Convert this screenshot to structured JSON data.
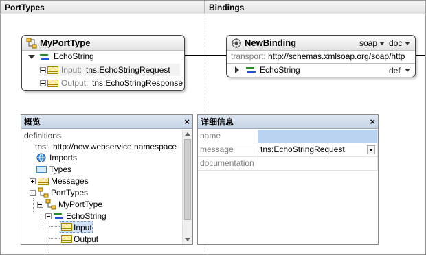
{
  "columns": {
    "port_types": "PortTypes",
    "bindings": "Bindings"
  },
  "port_type_box": {
    "title": "MyPortType",
    "operation": "EchoString",
    "input_label": "Input:",
    "input_value": "tns:EchoStringRequest",
    "output_label": "Output:",
    "output_value": "tns:EchoStringResponse"
  },
  "binding_box": {
    "title": "NewBinding",
    "protocol": "soap",
    "style": "doc",
    "transport_label": "transport:",
    "transport_value": "http://schemas.xmlsoap.org/soap/http",
    "operation": "EchoString",
    "operation_style": "def"
  },
  "overview_panel": {
    "title": "概览",
    "close": "×",
    "definitions": "definitions",
    "tns_label": "tns:",
    "tns_value": "http://new.webservice.namespace",
    "imports": "Imports",
    "types": "Types",
    "messages": "Messages",
    "port_types": "PortTypes",
    "port_type": "MyPortType",
    "operation": "EchoString",
    "input": "Input",
    "output": "Output"
  },
  "details_panel": {
    "title": "详细信息",
    "close": "×",
    "rows": [
      {
        "name": "name",
        "value": ""
      },
      {
        "name": "message",
        "value": "tns:EchoStringRequest"
      },
      {
        "name": "documentation",
        "value": ""
      }
    ]
  },
  "colors": {
    "header_blue": "#c6d4e5",
    "selection": "#cfe0f6",
    "name_row": "#b9d3f0"
  }
}
